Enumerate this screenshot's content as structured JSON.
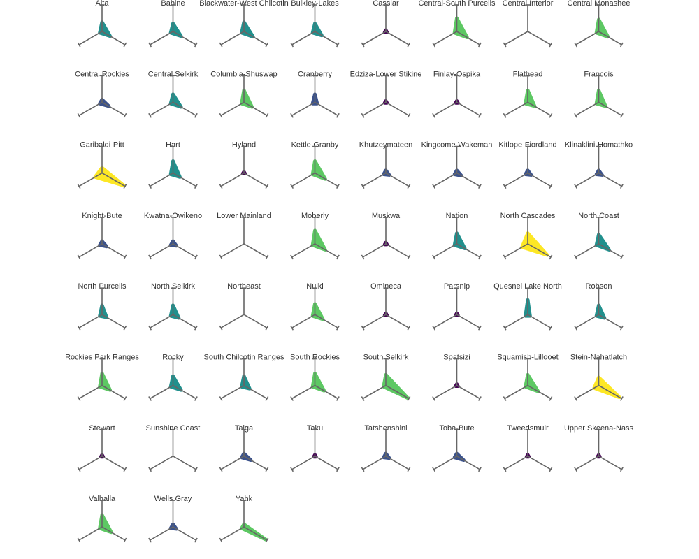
{
  "chart_data": {
    "type": "radar",
    "layout": "small-multiples",
    "columns": 8,
    "title": "",
    "axes": [
      {
        "angle_deg": 90
      },
      {
        "angle_deg": 330
      },
      {
        "angle_deg": 210
      }
    ],
    "value_range": [
      0,
      1
    ],
    "axis_color": "#666666",
    "color_scale": {
      "name": "viridis",
      "stops": [
        "#440154",
        "#3b528b",
        "#21908d",
        "#5dc863",
        "#fde725"
      ]
    },
    "panels": [
      {
        "name": "Alta",
        "values": [
          0.35,
          0.35,
          0.1
        ],
        "color": "#21908d"
      },
      {
        "name": "Babine",
        "values": [
          0.3,
          0.35,
          0.1
        ],
        "color": "#21908d"
      },
      {
        "name": "Blackwater-West Chilcotin",
        "values": [
          0.35,
          0.4,
          0.1
        ],
        "color": "#21908d"
      },
      {
        "name": "Bulkley-Lakes",
        "values": [
          0.3,
          0.3,
          0.1
        ],
        "color": "#21908d"
      },
      {
        "name": "Cassiar",
        "values": [
          0.05,
          0.05,
          0.05
        ],
        "color": "#440154"
      },
      {
        "name": "Central-South Purcells",
        "values": [
          0.5,
          0.45,
          0.1
        ],
        "color": "#5dc863"
      },
      {
        "name": "Central Interior",
        "values": [
          0,
          0,
          0
        ],
        "color": "#666666"
      },
      {
        "name": "Central Monashee",
        "values": [
          0.45,
          0.4,
          0.1
        ],
        "color": "#5dc863"
      },
      {
        "name": "Central Rockies",
        "values": [
          0.1,
          0.3,
          0.1
        ],
        "color": "#3b528b"
      },
      {
        "name": "Central Selkirk",
        "values": [
          0.3,
          0.35,
          0.1
        ],
        "color": "#21908d"
      },
      {
        "name": "Columbia-Shuswap",
        "values": [
          0.45,
          0.35,
          0.1
        ],
        "color": "#5dc863"
      },
      {
        "name": "Cranberry",
        "values": [
          0.3,
          0.1,
          0.1
        ],
        "color": "#3b528b"
      },
      {
        "name": "Edziza-Lower Stikine",
        "values": [
          0.05,
          0.05,
          0.05
        ],
        "color": "#440154"
      },
      {
        "name": "Finlay-Ospika",
        "values": [
          0.05,
          0.05,
          0.05
        ],
        "color": "#440154"
      },
      {
        "name": "Flathead",
        "values": [
          0.45,
          0.3,
          0.1
        ],
        "color": "#5dc863"
      },
      {
        "name": "Francois",
        "values": [
          0.45,
          0.3,
          0.1
        ],
        "color": "#5dc863"
      },
      {
        "name": "Garibaldi-Pitt",
        "values": [
          0.2,
          0.95,
          0.3
        ],
        "color": "#fde725"
      },
      {
        "name": "Hart",
        "values": [
          0.45,
          0.3,
          0.1
        ],
        "color": "#21908d"
      },
      {
        "name": "Hyland",
        "values": [
          0.05,
          0.05,
          0.05
        ],
        "color": "#440154"
      },
      {
        "name": "Kettle-Granby",
        "values": [
          0.45,
          0.45,
          0.1
        ],
        "color": "#5dc863"
      },
      {
        "name": "Khutzeymateen",
        "values": [
          0.1,
          0.15,
          0.1
        ],
        "color": "#3b528b"
      },
      {
        "name": "Kingcome-Wakeman",
        "values": [
          0.1,
          0.2,
          0.1
        ],
        "color": "#3b528b"
      },
      {
        "name": "Kitlope-Fiordland",
        "values": [
          0.1,
          0.15,
          0.1
        ],
        "color": "#3b528b"
      },
      {
        "name": "Klinaklini-Homathko",
        "values": [
          0.1,
          0.15,
          0.1
        ],
        "color": "#3b528b"
      },
      {
        "name": "Knight-Bute",
        "values": [
          0.1,
          0.2,
          0.1
        ],
        "color": "#3b528b"
      },
      {
        "name": "Kwatna-Owikeno",
        "values": [
          0.1,
          0.15,
          0.1
        ],
        "color": "#3b528b"
      },
      {
        "name": "Lower Mainland",
        "values": [
          0,
          0,
          0
        ],
        "color": "#666666"
      },
      {
        "name": "Moberly",
        "values": [
          0.5,
          0.45,
          0.1
        ],
        "color": "#5dc863"
      },
      {
        "name": "Muskwa",
        "values": [
          0.05,
          0.05,
          0.05
        ],
        "color": "#440154"
      },
      {
        "name": "Nation",
        "values": [
          0.4,
          0.35,
          0.1
        ],
        "color": "#21908d"
      },
      {
        "name": "North Cascades",
        "values": [
          0.4,
          0.85,
          0.25
        ],
        "color": "#fde725"
      },
      {
        "name": "North Coast",
        "values": [
          0.35,
          0.45,
          0.1
        ],
        "color": "#21908d"
      },
      {
        "name": "North Purcells",
        "values": [
          0.35,
          0.2,
          0.1
        ],
        "color": "#21908d"
      },
      {
        "name": "North Selkirk",
        "values": [
          0.35,
          0.25,
          0.1
        ],
        "color": "#21908d"
      },
      {
        "name": "Northeast",
        "values": [
          0,
          0,
          0
        ],
        "color": "#666666"
      },
      {
        "name": "Nulki",
        "values": [
          0.4,
          0.35,
          0.1
        ],
        "color": "#5dc863"
      },
      {
        "name": "Omineca",
        "values": [
          0.05,
          0.05,
          0.05
        ],
        "color": "#440154"
      },
      {
        "name": "Parsnip",
        "values": [
          0.05,
          0.05,
          0.05
        ],
        "color": "#440154"
      },
      {
        "name": "Quesnel Lake North",
        "values": [
          0.55,
          0.1,
          0.1
        ],
        "color": "#21908d"
      },
      {
        "name": "Robson",
        "values": [
          0.35,
          0.25,
          0.1
        ],
        "color": "#21908d"
      },
      {
        "name": "Rockies Park Ranges",
        "values": [
          0.45,
          0.35,
          0.1
        ],
        "color": "#5dc863"
      },
      {
        "name": "Rocky",
        "values": [
          0.35,
          0.35,
          0.1
        ],
        "color": "#21908d"
      },
      {
        "name": "South Chilcotin Ranges",
        "values": [
          0.35,
          0.25,
          0.1
        ],
        "color": "#21908d"
      },
      {
        "name": "South Rockies",
        "values": [
          0.45,
          0.4,
          0.1
        ],
        "color": "#5dc863"
      },
      {
        "name": "South Selkirk",
        "values": [
          0.4,
          0.95,
          0.1
        ],
        "color": "#5dc863"
      },
      {
        "name": "Spatsizi",
        "values": [
          0.05,
          0.05,
          0.05
        ],
        "color": "#440154"
      },
      {
        "name": "Squamish-Lillooet",
        "values": [
          0.4,
          0.45,
          0.1
        ],
        "color": "#5dc863"
      },
      {
        "name": "Stein-Nahatlatch",
        "values": [
          0.3,
          0.9,
          0.2
        ],
        "color": "#fde725"
      },
      {
        "name": "Stewart",
        "values": [
          0.05,
          0.05,
          0.05
        ],
        "color": "#440154"
      },
      {
        "name": "Sunshine Coast",
        "values": [
          0,
          0,
          0
        ],
        "color": "#666666"
      },
      {
        "name": "Taiga",
        "values": [
          0.1,
          0.3,
          0.1
        ],
        "color": "#3b528b"
      },
      {
        "name": "Taku",
        "values": [
          0.05,
          0.05,
          0.05
        ],
        "color": "#440154"
      },
      {
        "name": "Tatshenshini",
        "values": [
          0.1,
          0.15,
          0.1
        ],
        "color": "#3b528b"
      },
      {
        "name": "Toba-Bute",
        "values": [
          0.1,
          0.3,
          0.1
        ],
        "color": "#3b528b"
      },
      {
        "name": "Tweedsmuir",
        "values": [
          0.05,
          0.05,
          0.05
        ],
        "color": "#440154"
      },
      {
        "name": "Upper Skeena-Nass",
        "values": [
          0.05,
          0.05,
          0.05
        ],
        "color": "#440154"
      },
      {
        "name": "Valhalla",
        "values": [
          0.45,
          0.4,
          0.1
        ],
        "color": "#5dc863"
      },
      {
        "name": "Wells Gray",
        "values": [
          0.1,
          0.15,
          0.1
        ],
        "color": "#3b528b"
      },
      {
        "name": "Yahk",
        "values": [
          0.1,
          0.95,
          0.1
        ],
        "color": "#5dc863"
      }
    ]
  }
}
